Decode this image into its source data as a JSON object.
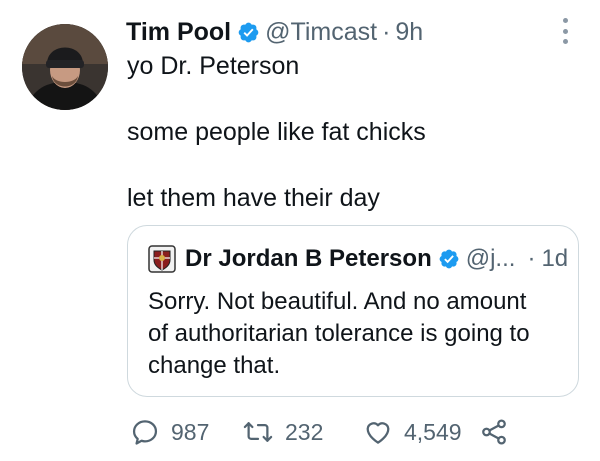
{
  "tweet": {
    "author_name": "Tim Pool",
    "handle": "@Timcast",
    "separator": "·",
    "time": "9h",
    "text_lines": [
      "yo Dr. Peterson",
      "some people like fat chicks",
      "let them have their day"
    ]
  },
  "quoted_tweet": {
    "author_name": "Dr Jordan B Peterson",
    "handle": "@j...",
    "separator": "·",
    "time": "1d",
    "text_lines": [
      "Sorry. Not beautiful. And no amount",
      "of authoritarian tolerance is going to",
      "change that."
    ]
  },
  "actions": {
    "replies": "987",
    "retweets": "232",
    "likes": "4,549"
  },
  "icons": {
    "verified": "verified-badge-icon",
    "more": "more-vertical-icon",
    "reply": "reply-icon",
    "retweet": "retweet-icon",
    "like": "heart-icon",
    "share": "share-icon"
  },
  "colors": {
    "verified_blue": "#1d9bf0",
    "secondary_text": "#536471",
    "primary_text": "#0f1419",
    "border": "#cfd9de"
  }
}
